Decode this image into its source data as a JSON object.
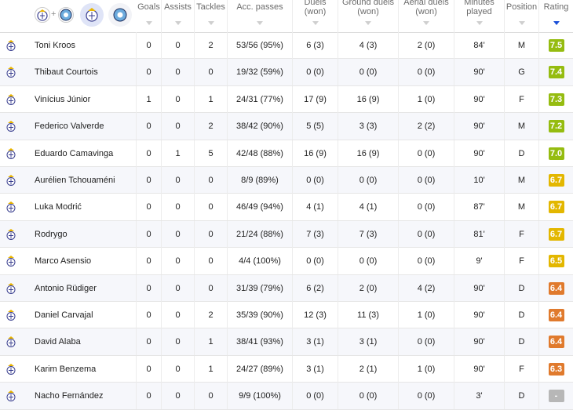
{
  "colors": {
    "rating_high": "#95bc10",
    "rating_mid": "#e3b700",
    "rating_low": "#e07a2d",
    "rating_none": "#b7b7b7",
    "accent": "#1a4fd8"
  },
  "header": {
    "team_icons": [
      "real-madrid-crest-icon",
      "plus-icon",
      "manchester-city-crest-icon",
      "real-madrid-crest-icon",
      "manchester-city-crest-icon"
    ],
    "plus": "+",
    "columns": [
      "Goals",
      "Assists",
      "Tackles",
      "Acc. passes",
      "Duels (won)",
      "Ground duels (won)",
      "Aerial duels (won)",
      "Minutes played",
      "Position",
      "Rating"
    ]
  },
  "rows": [
    {
      "name": "Toni Kroos",
      "goals": "0",
      "assists": "0",
      "tackles": "2",
      "passes": "53/56 (95%)",
      "duels": "6 (3)",
      "ground": "4 (3)",
      "aerial": "2 (0)",
      "minutes": "84'",
      "position": "M",
      "rating": "7.5",
      "rating_level": "high"
    },
    {
      "name": "Thibaut Courtois",
      "goals": "0",
      "assists": "0",
      "tackles": "0",
      "passes": "19/32 (59%)",
      "duels": "0 (0)",
      "ground": "0 (0)",
      "aerial": "0 (0)",
      "minutes": "90'",
      "position": "G",
      "rating": "7.4",
      "rating_level": "high"
    },
    {
      "name": "Vinícius Júnior",
      "goals": "1",
      "assists": "0",
      "tackles": "1",
      "passes": "24/31 (77%)",
      "duels": "17 (9)",
      "ground": "16 (9)",
      "aerial": "1 (0)",
      "minutes": "90'",
      "position": "F",
      "rating": "7.3",
      "rating_level": "high"
    },
    {
      "name": "Federico Valverde",
      "goals": "0",
      "assists": "0",
      "tackles": "2",
      "passes": "38/42 (90%)",
      "duels": "5 (5)",
      "ground": "3 (3)",
      "aerial": "2 (2)",
      "minutes": "90'",
      "position": "M",
      "rating": "7.2",
      "rating_level": "high"
    },
    {
      "name": "Eduardo Camavinga",
      "goals": "0",
      "assists": "1",
      "tackles": "5",
      "passes": "42/48 (88%)",
      "duels": "16 (9)",
      "ground": "16 (9)",
      "aerial": "0 (0)",
      "minutes": "90'",
      "position": "D",
      "rating": "7.0",
      "rating_level": "high"
    },
    {
      "name": "Aurélien Tchouaméni",
      "goals": "0",
      "assists": "0",
      "tackles": "0",
      "passes": "8/9 (89%)",
      "duels": "0 (0)",
      "ground": "0 (0)",
      "aerial": "0 (0)",
      "minutes": "10'",
      "position": "M",
      "rating": "6.7",
      "rating_level": "mid"
    },
    {
      "name": "Luka Modrić",
      "goals": "0",
      "assists": "0",
      "tackles": "0",
      "passes": "46/49 (94%)",
      "duels": "4 (1)",
      "ground": "4 (1)",
      "aerial": "0 (0)",
      "minutes": "87'",
      "position": "M",
      "rating": "6.7",
      "rating_level": "mid"
    },
    {
      "name": "Rodrygo",
      "goals": "0",
      "assists": "0",
      "tackles": "0",
      "passes": "21/24 (88%)",
      "duels": "7 (3)",
      "ground": "7 (3)",
      "aerial": "0 (0)",
      "minutes": "81'",
      "position": "F",
      "rating": "6.7",
      "rating_level": "mid"
    },
    {
      "name": "Marco Asensio",
      "goals": "0",
      "assists": "0",
      "tackles": "0",
      "passes": "4/4 (100%)",
      "duels": "0 (0)",
      "ground": "0 (0)",
      "aerial": "0 (0)",
      "minutes": "9'",
      "position": "F",
      "rating": "6.5",
      "rating_level": "mid"
    },
    {
      "name": "Antonio Rüdiger",
      "goals": "0",
      "assists": "0",
      "tackles": "0",
      "passes": "31/39 (79%)",
      "duels": "6 (2)",
      "ground": "2 (0)",
      "aerial": "4 (2)",
      "minutes": "90'",
      "position": "D",
      "rating": "6.4",
      "rating_level": "low"
    },
    {
      "name": "Daniel Carvajal",
      "goals": "0",
      "assists": "0",
      "tackles": "2",
      "passes": "35/39 (90%)",
      "duels": "12 (3)",
      "ground": "11 (3)",
      "aerial": "1 (0)",
      "minutes": "90'",
      "position": "D",
      "rating": "6.4",
      "rating_level": "low"
    },
    {
      "name": "David Alaba",
      "goals": "0",
      "assists": "0",
      "tackles": "1",
      "passes": "38/41 (93%)",
      "duels": "3 (1)",
      "ground": "3 (1)",
      "aerial": "0 (0)",
      "minutes": "90'",
      "position": "D",
      "rating": "6.4",
      "rating_level": "low"
    },
    {
      "name": "Karim Benzema",
      "goals": "0",
      "assists": "0",
      "tackles": "1",
      "passes": "24/27 (89%)",
      "duels": "3 (1)",
      "ground": "2 (1)",
      "aerial": "1 (0)",
      "minutes": "90'",
      "position": "F",
      "rating": "6.3",
      "rating_level": "low"
    },
    {
      "name": "Nacho Fernández",
      "goals": "0",
      "assists": "0",
      "tackles": "0",
      "passes": "9/9 (100%)",
      "duels": "0 (0)",
      "ground": "0 (0)",
      "aerial": "0 (0)",
      "minutes": "3'",
      "position": "D",
      "rating": "-",
      "rating_level": "none"
    }
  ]
}
